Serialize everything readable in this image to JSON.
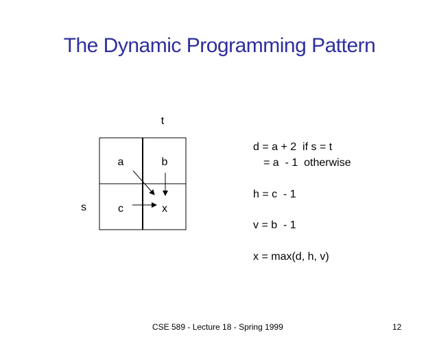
{
  "title": {
    "text": "The Dynamic Programming Pattern",
    "color": "#2e2e9e"
  },
  "diagram": {
    "col_label": "t",
    "row_label": "s",
    "cells": {
      "a": "a",
      "b": "b",
      "c": "c",
      "x": "x"
    }
  },
  "equations": {
    "d_line1": "d = a + 2  if s = t",
    "d_line2": "= a  - 1  otherwise",
    "h": "h = c  - 1",
    "v": "v = b  - 1",
    "x": "x = max(d, h, v)"
  },
  "footer": {
    "text": "CSE 589 - Lecture 18 - Spring 1999",
    "page_number": "12"
  }
}
